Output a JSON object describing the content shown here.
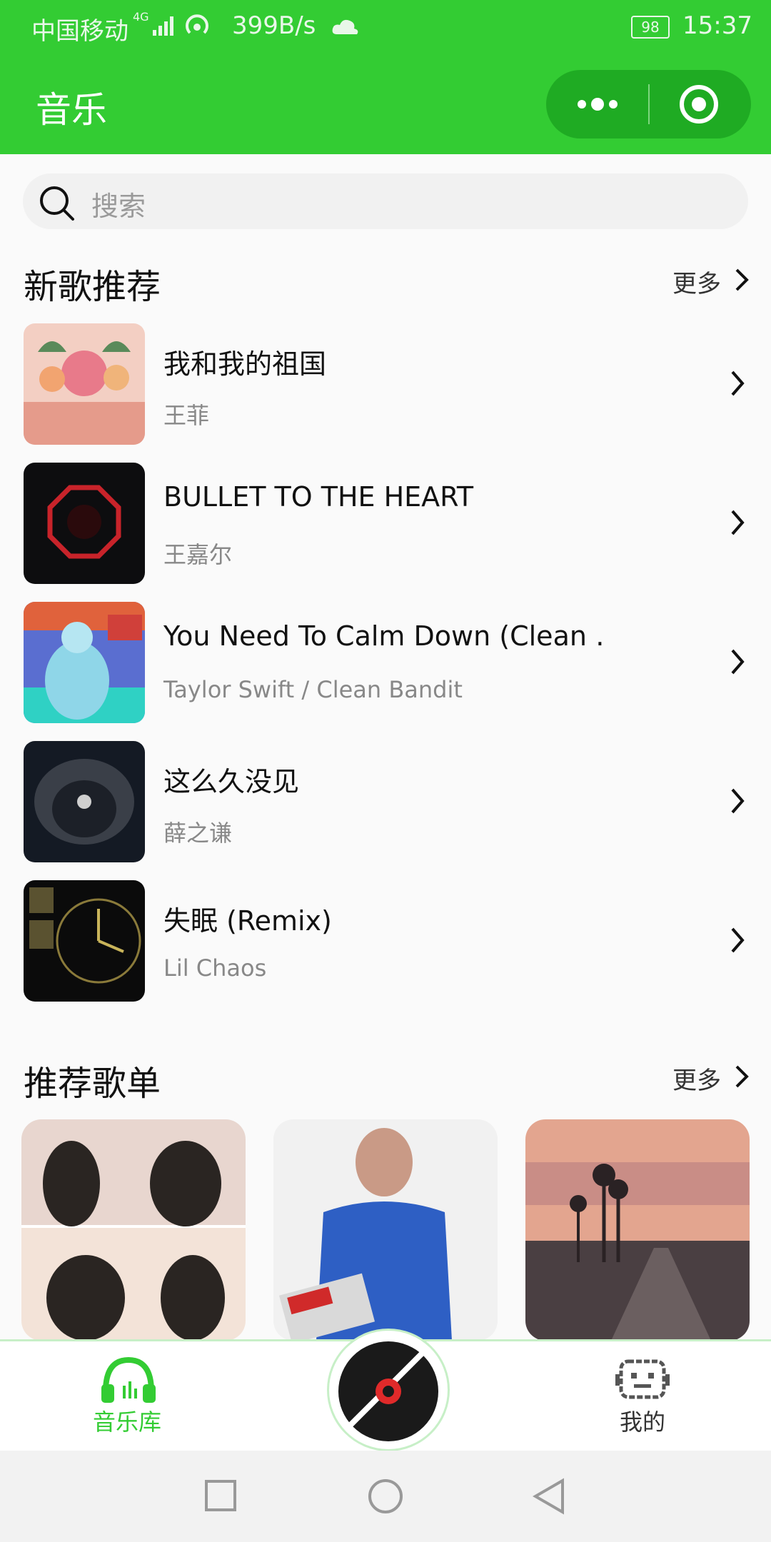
{
  "status_bar": {
    "carrier": "中国移动",
    "network": "4G",
    "speed": "399B/s",
    "battery": "98",
    "time": "15:37"
  },
  "header": {
    "title": "音乐",
    "menu_icon": "more-dots-icon",
    "close_icon": "target-circle-icon"
  },
  "search": {
    "placeholder": "搜索",
    "icon": "search-icon"
  },
  "new_songs": {
    "title": "新歌推荐",
    "more_label": "更多",
    "items": [
      {
        "title": "我和我的祖国",
        "artist": "王菲"
      },
      {
        "title": "BULLET TO THE HEART",
        "artist": "王嘉尔"
      },
      {
        "title": "You Need To Calm Down (Clean …",
        "artist": "Taylor Swift / Clean Bandit"
      },
      {
        "title": "这么久没见",
        "artist": "薛之谦"
      },
      {
        "title": "失眠 (Remix)",
        "artist": "Lil Chaos"
      }
    ]
  },
  "playlists": {
    "title": "推荐歌单",
    "more_label": "更多"
  },
  "tab_bar": {
    "library_label": "音乐库",
    "mine_label": "我的",
    "active_color": "#33cc33"
  },
  "colors": {
    "brand": "#33cc33",
    "capsule": "#1fab23"
  }
}
